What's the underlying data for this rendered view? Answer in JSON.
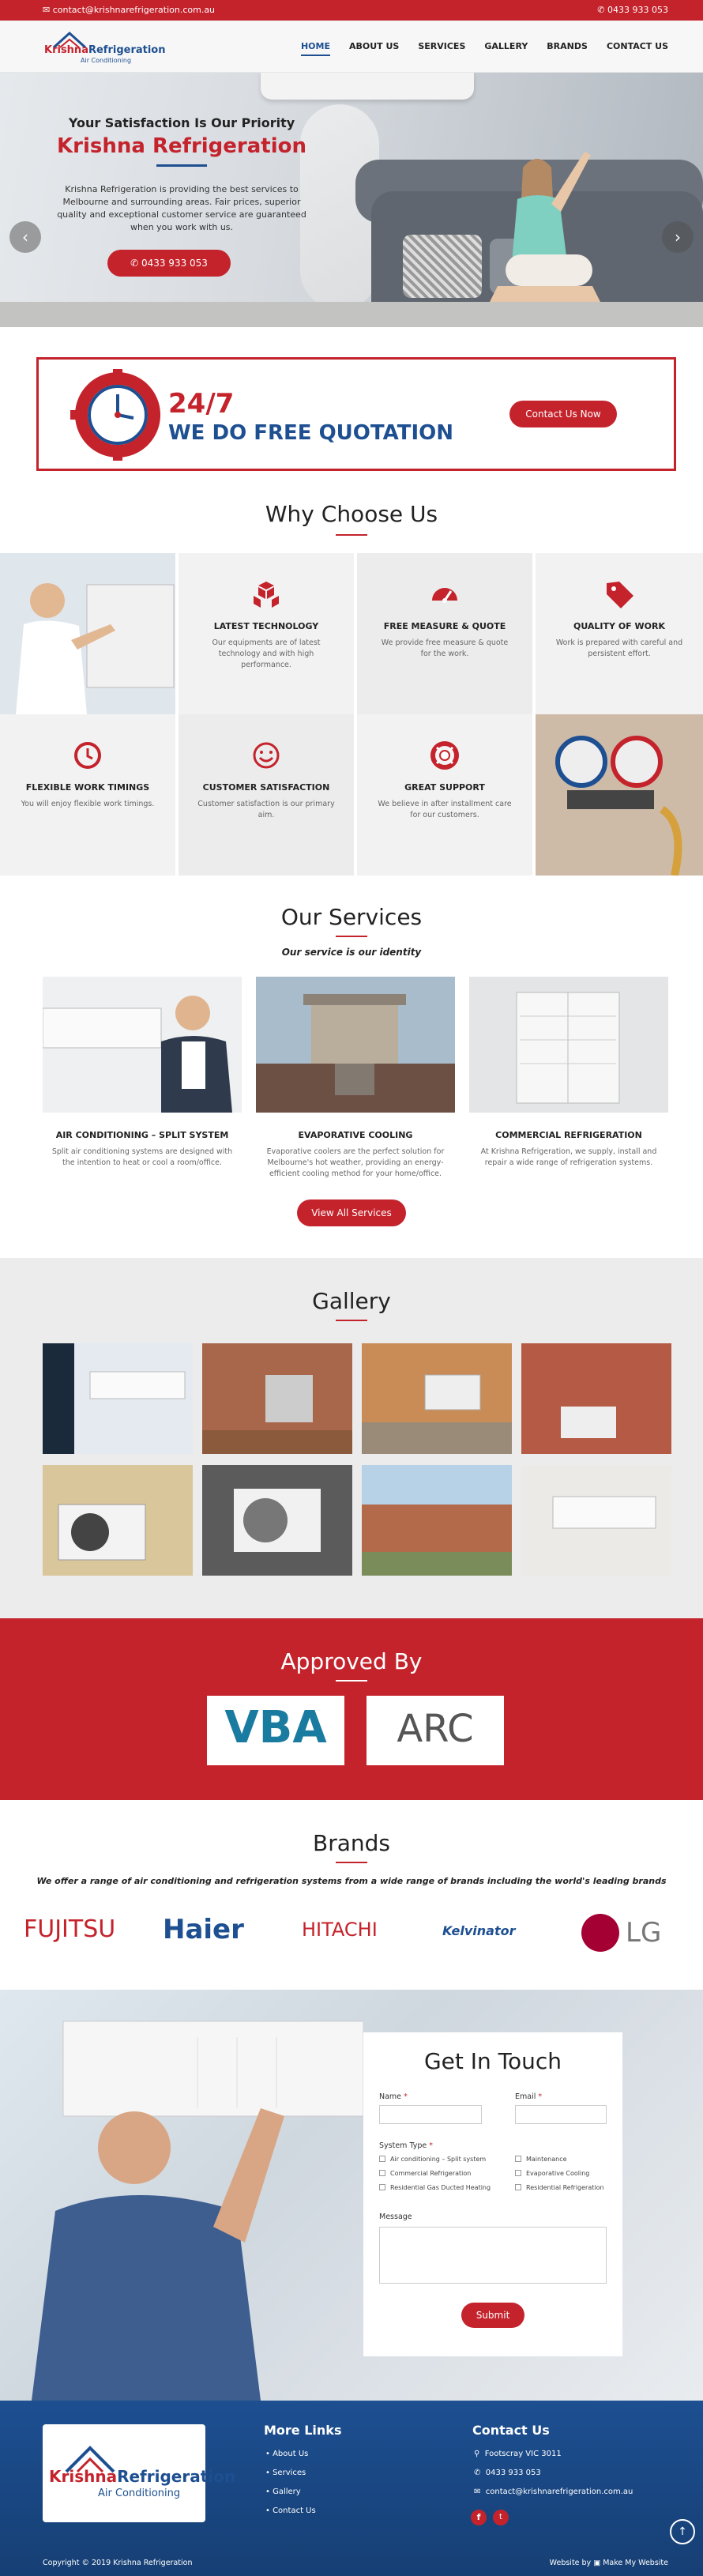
{
  "topbar": {
    "email": "contact@krishnarefrigeration.com.au",
    "phone": "0433 933 053"
  },
  "logo": {
    "line1a": "Krishna",
    "line1b": "Refrigeration",
    "line2": "Air Conditioning"
  },
  "nav": {
    "items": [
      "HOME",
      "ABOUT US",
      "SERVICES",
      "GALLERY",
      "BRANDS",
      "CONTACT US"
    ],
    "active": "HOME"
  },
  "hero": {
    "kicker": "Your Satisfaction Is Our Priority",
    "title": "Krishna Refrigeration",
    "text": "Krishna Refrigeration is providing the best services to Melbourne and surrounding areas. Fair prices, superior quality and exceptional customer service are guaranteed when you work with us.",
    "phone_button": "0433 933 053",
    "prev": "‹",
    "next": "›"
  },
  "quote": {
    "big": "24/7",
    "title": "WE DO FREE QUOTATION",
    "button": "Contact Us Now"
  },
  "why": {
    "title": "Why Choose Us",
    "items": [
      {
        "icon": "cubes-icon",
        "title": "LATEST TECHNOLOGY",
        "text": "Our equipments are of latest technology and with high performance."
      },
      {
        "icon": "gauge-icon",
        "title": "FREE MEASURE & QUOTE",
        "text": "We provide free measure & quote for the work."
      },
      {
        "icon": "tag-icon",
        "title": "QUALITY OF WORK",
        "text": "Work is prepared with careful and persistent effort."
      },
      {
        "icon": "clock-icon",
        "title": "FLEXIBLE WORK TIMINGS",
        "text": "You will enjoy flexible work timings."
      },
      {
        "icon": "smile-icon",
        "title": "CUSTOMER SATISFACTION",
        "text": "Customer satisfaction is our primary aim."
      },
      {
        "icon": "lifebuoy-icon",
        "title": "GREAT SUPPORT",
        "text": "We believe in after installment care for our customers."
      }
    ]
  },
  "services": {
    "title": "Our Services",
    "subtitle": "Our service is our identity",
    "items": [
      {
        "title": "AIR CONDITIONING – SPLIT SYSTEM",
        "text": "Split air conditioning systems are designed with the intention to heat or cool a room/office."
      },
      {
        "title": "EVAPORATIVE COOLING",
        "text": "Evaporative coolers are the perfect solution for Melbourne's hot weather, providing an energy-efficient cooling method for your home/office."
      },
      {
        "title": "COMMERCIAL REFRIGERATION",
        "text": "At Krishna Refrigeration, we supply, install and repair a wide range of refrigeration systems."
      }
    ],
    "button": "View All Services"
  },
  "gallery": {
    "title": "Gallery"
  },
  "approved": {
    "title": "Approved By",
    "logos": [
      "VBA",
      "ARC"
    ]
  },
  "brands": {
    "title": "Brands",
    "subtitle": "We offer a range of air conditioning and refrigeration systems from a wide range of brands including the world's leading brands",
    "items": [
      "FUJITSU",
      "Haier",
      "HITACHI",
      "Kelvinator",
      "LG"
    ]
  },
  "contact": {
    "title": "Get In Touch",
    "name_label": "Name",
    "email_label": "Email",
    "system_label": "System Type",
    "options": [
      "Air conditioning – Split system",
      "Maintenance",
      "Commercial Refrigeration",
      "Evaporative Cooling",
      "Residential Gas Ducted Heating",
      "Residential Refrigeration"
    ],
    "message_label": "Message",
    "submit": "Submit"
  },
  "footer": {
    "links_title": "More Links",
    "links": [
      "About Us",
      "Services",
      "Gallery",
      "Contact Us"
    ],
    "contact_title": "Contact Us",
    "address": "Footscray VIC 3011",
    "phone": "0433 933 053",
    "email": "contact@krishnarefrigeration.com.au",
    "copyright": "Copyright © 2019 Krishna Refrigeration",
    "credit_prefix": "Website by",
    "credit_brand": "Make My Website"
  },
  "colors": {
    "red": "#c4232c",
    "blue": "#1d4f91"
  }
}
